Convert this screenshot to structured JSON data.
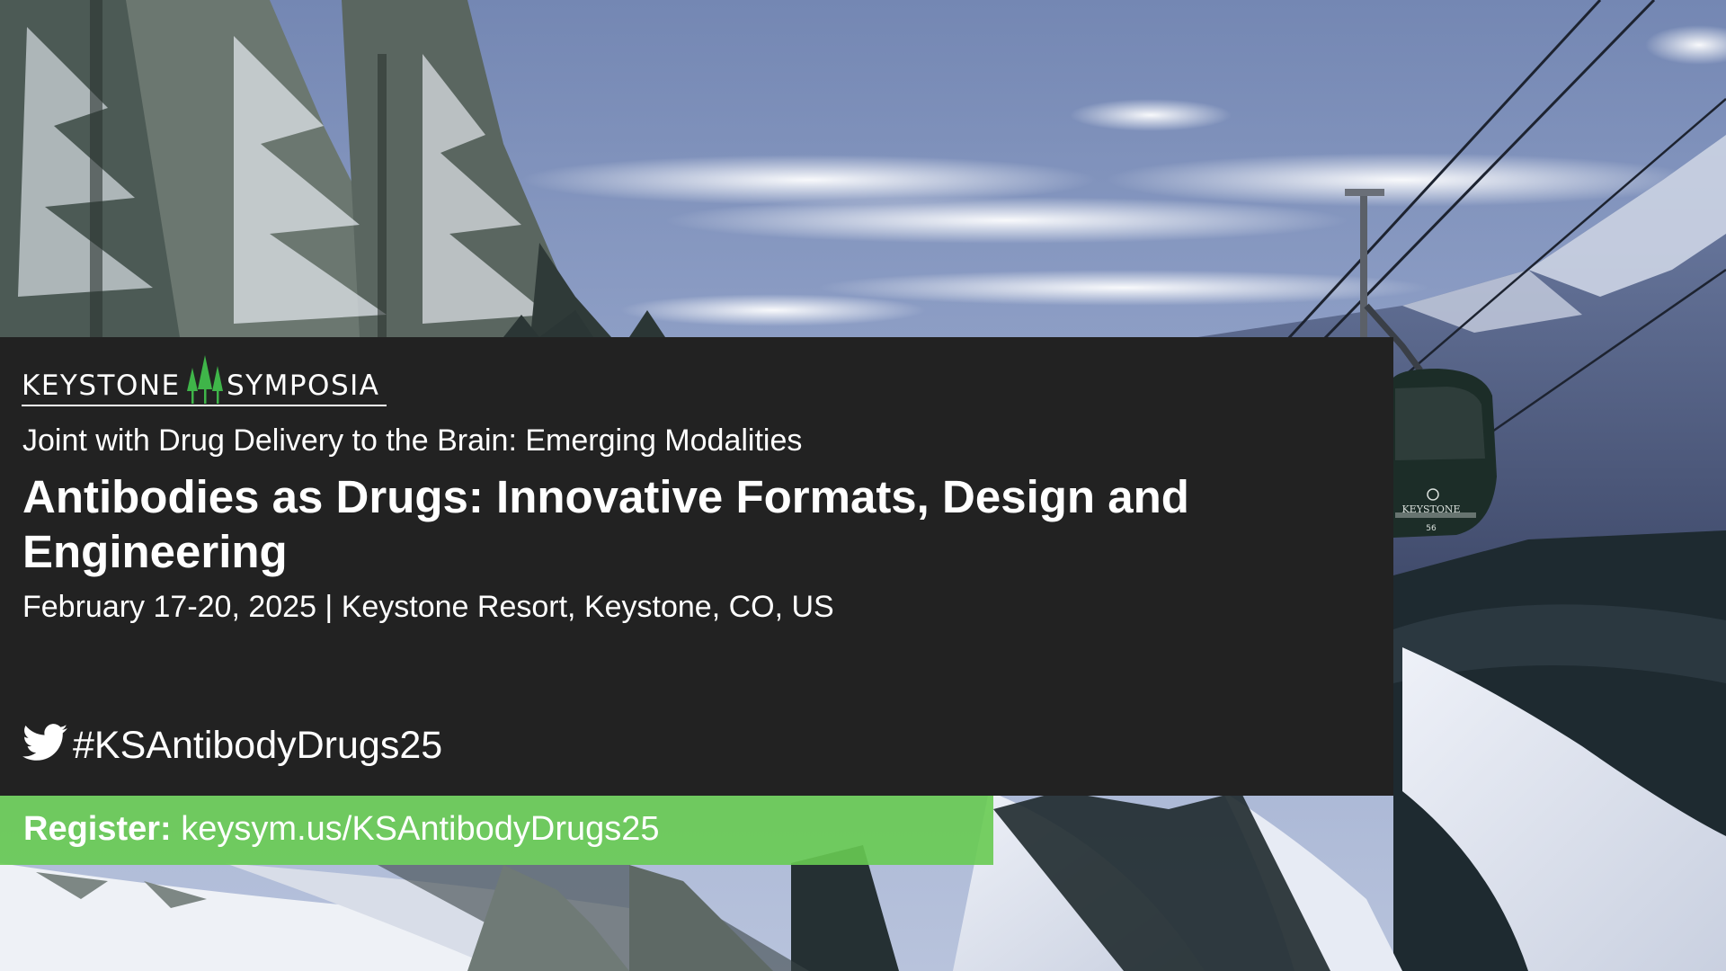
{
  "logo": {
    "left_word": "KEYSTONE",
    "right_word": "SYMPOSIA",
    "tree_color": "#3fb549"
  },
  "event": {
    "subtitle": "Joint with Drug Delivery to the Brain: Emerging Modalities",
    "title": "Antibodies as Drugs: Innovative Formats, Design and Engineering",
    "date_location": "February 17-20, 2025 | Keystone Resort, Keystone, CO, US"
  },
  "social": {
    "icon": "twitter-bird-icon",
    "hashtag": "#KSAntibodyDrugs25"
  },
  "register": {
    "label": "Register:",
    "link": "keysym.us/KSAntibodyDrugs25",
    "bar_color": "#68cb52"
  },
  "photo": {
    "gondola_text": "KEYSTONE",
    "gondola_number": "56"
  },
  "colors": {
    "panel": "#222222",
    "text": "#ffffff"
  }
}
